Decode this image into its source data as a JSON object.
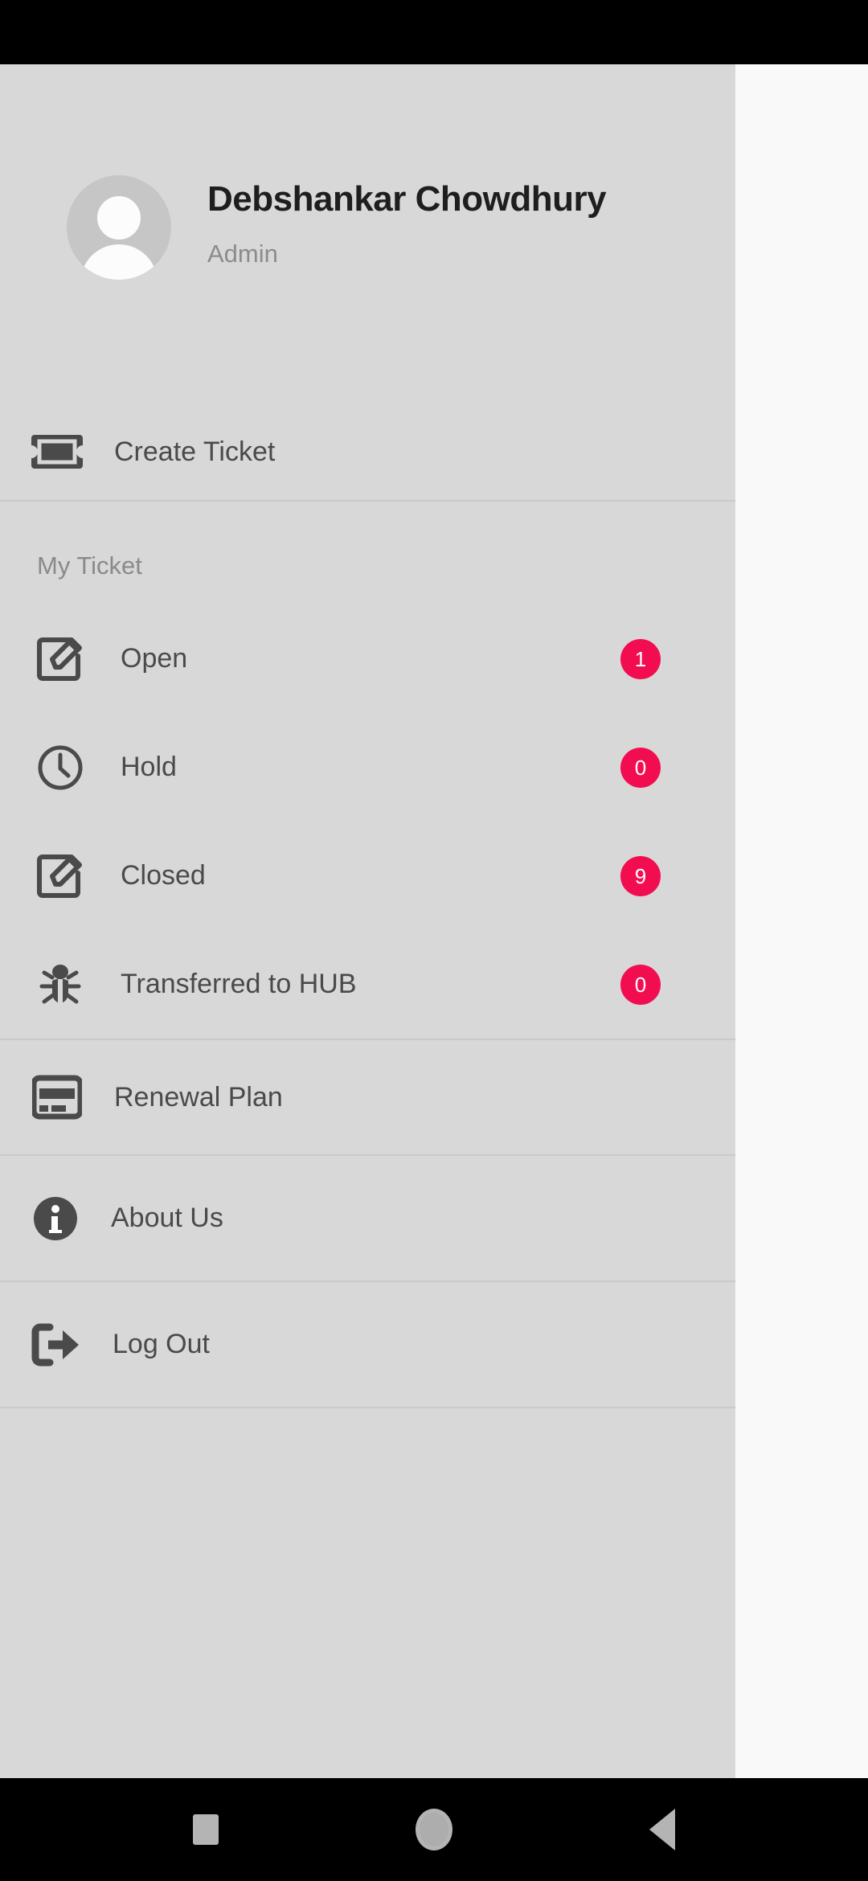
{
  "app": {
    "accent_badge_color": "#F20D51",
    "drawer_background": "#D8D8D8",
    "scrim_background": "#F9F9F9",
    "icon_color": "#4A4A4A"
  },
  "drawer": {
    "profile": {
      "name": "Debshankar Chowdhury",
      "role": "Admin",
      "avatar_icon": "person-avatar-icon"
    },
    "create_ticket": {
      "label": "Create Ticket",
      "icon": "ticket-icon"
    },
    "my_ticket_section": {
      "title": "My Ticket",
      "items": [
        {
          "label": "Open",
          "badge": "1",
          "icon": "edit-square-icon"
        },
        {
          "label": "Hold",
          "badge": "0",
          "icon": "clock-icon"
        },
        {
          "label": "Closed",
          "badge": "9",
          "icon": "edit-square-icon"
        },
        {
          "label": "Transferred to HUB",
          "badge": "0",
          "icon": "bug-icon"
        }
      ]
    },
    "renewal_plan": {
      "label": "Renewal Plan",
      "icon": "credit-card-icon"
    },
    "about_us": {
      "label": "About Us",
      "icon": "info-circle-icon"
    },
    "log_out": {
      "label": "Log Out",
      "icon": "sign-out-icon"
    }
  },
  "navbar": {
    "recents": "recents-square-icon",
    "home": "home-circle-icon",
    "back": "back-triangle-icon"
  }
}
